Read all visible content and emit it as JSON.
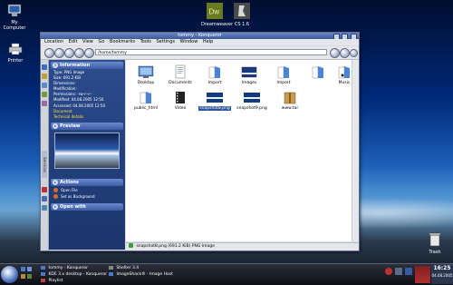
{
  "desktop": {
    "icons": [
      {
        "id": "my-computer",
        "label": "My Computer"
      },
      {
        "id": "printer",
        "label": "Printer"
      },
      {
        "id": "dreamweaver",
        "label": "Dreamweaver"
      },
      {
        "id": "cs16",
        "label": "CS 1.6"
      },
      {
        "id": "trash",
        "label": "Trash"
      }
    ]
  },
  "window": {
    "title": "tommy - Konqueror",
    "menu": [
      "Location",
      "Edit",
      "View",
      "Go",
      "Bookmarks",
      "Tools",
      "Settings",
      "Window",
      "Help"
    ],
    "address": "/home/tommy",
    "side_tab_label": "Services",
    "info_panel": {
      "header": "Information",
      "lines": [
        "Type: PNG Image",
        "Size: 691.2 KiB",
        "Dimensions:",
        "Modification:",
        "Permissions: -rw-r--r--",
        "Modified: 04.08.2005 12:50",
        "Accessed: 04.08.2005 12:50"
      ],
      "links": [
        "Document",
        "Technical details"
      ],
      "preview_header": "Preview",
      "actions_header": "Actions",
      "actions": [
        "Open File",
        "Set as Background"
      ],
      "open_with_header": "Open with"
    },
    "files": [
      {
        "name": "Desktop",
        "kind": "folder"
      },
      {
        "name": "Documents",
        "kind": "folder"
      },
      {
        "name": "Import",
        "kind": "folder"
      },
      {
        "name": "Images",
        "kind": "folder"
      },
      {
        "name": "Import",
        "kind": "folder"
      },
      {
        "name": "",
        "kind": "folder"
      },
      {
        "name": "Music",
        "kind": "folder"
      },
      {
        "name": "public_html",
        "kind": "folder"
      },
      {
        "name": "Video",
        "kind": "folder"
      },
      {
        "name": "snapshot8.png",
        "kind": "image",
        "selected": true
      },
      {
        "name": "snapshot9.png",
        "kind": "image"
      },
      {
        "name": "www.tar",
        "kind": "archive"
      }
    ],
    "status": "snapshot8.png (691.2 KiB)  PNG Image"
  },
  "taskbar": {
    "tasks": [
      "tommy - Konqueror",
      "KDE 3.x desktop - Konqueror",
      "Playlist",
      "Shelter 3.4",
      "ImageShack® - Image Host"
    ],
    "clock_time": "16:25",
    "clock_date": "04.08.2005"
  }
}
